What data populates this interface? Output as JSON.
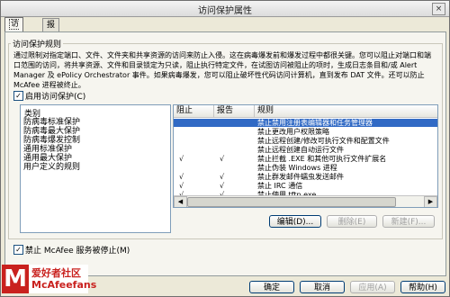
{
  "window": {
    "title": "访问保护属性",
    "close_glyph": "×"
  },
  "tabs": [
    {
      "label": "访问保护"
    },
    {
      "label": "报告"
    }
  ],
  "rules_group": {
    "legend": "访问保护规则",
    "description": "通过限制对指定端口、文件、文件夹和共享资源的访问来防止入侵。这在病毒爆发前和爆发过程中都很关键。您可以阻止对端口和端口范围的访问，将共享资源、文件和目录锁定为只读，阻止执行特定文件，在试图访问被阻止的项时，生成日志条目和/或 Alert Manager 及 ePolicy Orchestrator 事件。如果病毒爆发，您可以阻止破坏性代码访问计算机，直到发布 DAT 文件。还可以防止 McAfee 进程被终止。",
    "enable_label": "启用访问保护(C)",
    "enable_checked": true
  },
  "categories": {
    "header": "类别",
    "items": [
      "防病毒标准保护",
      "防病毒最大保护",
      "防病毒爆发控制",
      "通用标准保护",
      "通用最大保护",
      "用户定义的规则"
    ]
  },
  "rules_table": {
    "headers": [
      "阻止",
      "报告",
      "规则"
    ],
    "rows": [
      {
        "block": "",
        "report": "",
        "rule": "禁止禁用注册表编辑器和任务管理器",
        "selected": true
      },
      {
        "block": "",
        "report": "",
        "rule": "禁止更改用户权限策略",
        "selected": false
      },
      {
        "block": "",
        "report": "",
        "rule": "禁止远程创建/修改可执行文件和配置文件",
        "selected": false
      },
      {
        "block": "",
        "report": "",
        "rule": "禁止远程创建自动运行文件",
        "selected": false
      },
      {
        "block": "√",
        "report": "√",
        "rule": "禁止拦截 .EXE 和其他可执行文件扩展名",
        "selected": false
      },
      {
        "block": "",
        "report": "",
        "rule": "禁止伪装 Windows 进程",
        "selected": false
      },
      {
        "block": "√",
        "report": "√",
        "rule": "禁止群发邮件蠕虫发送邮件",
        "selected": false
      },
      {
        "block": "√",
        "report": "√",
        "rule": "禁止 IRC 通信",
        "selected": false
      },
      {
        "block": "√",
        "report": "√",
        "rule": "禁止使用 tftp.exe",
        "selected": false
      }
    ],
    "scroll_left_glyph": "◀",
    "scroll_right_glyph": "▶"
  },
  "rule_buttons": {
    "edit": "编辑(D)...",
    "delete": "删除(E)",
    "new": "新建(F)..."
  },
  "prevent_stop": {
    "label": "禁止 McAfee 服务被停止(M)",
    "checked": true
  },
  "dialog_buttons": {
    "ok": "确定",
    "cancel": "取消",
    "apply": "应用(A)",
    "help": "帮助(H)"
  },
  "watermark": {
    "mark": "M",
    "line1": "爱好者社区",
    "line2": "McAfeefans",
    "color": "#c9211e"
  }
}
